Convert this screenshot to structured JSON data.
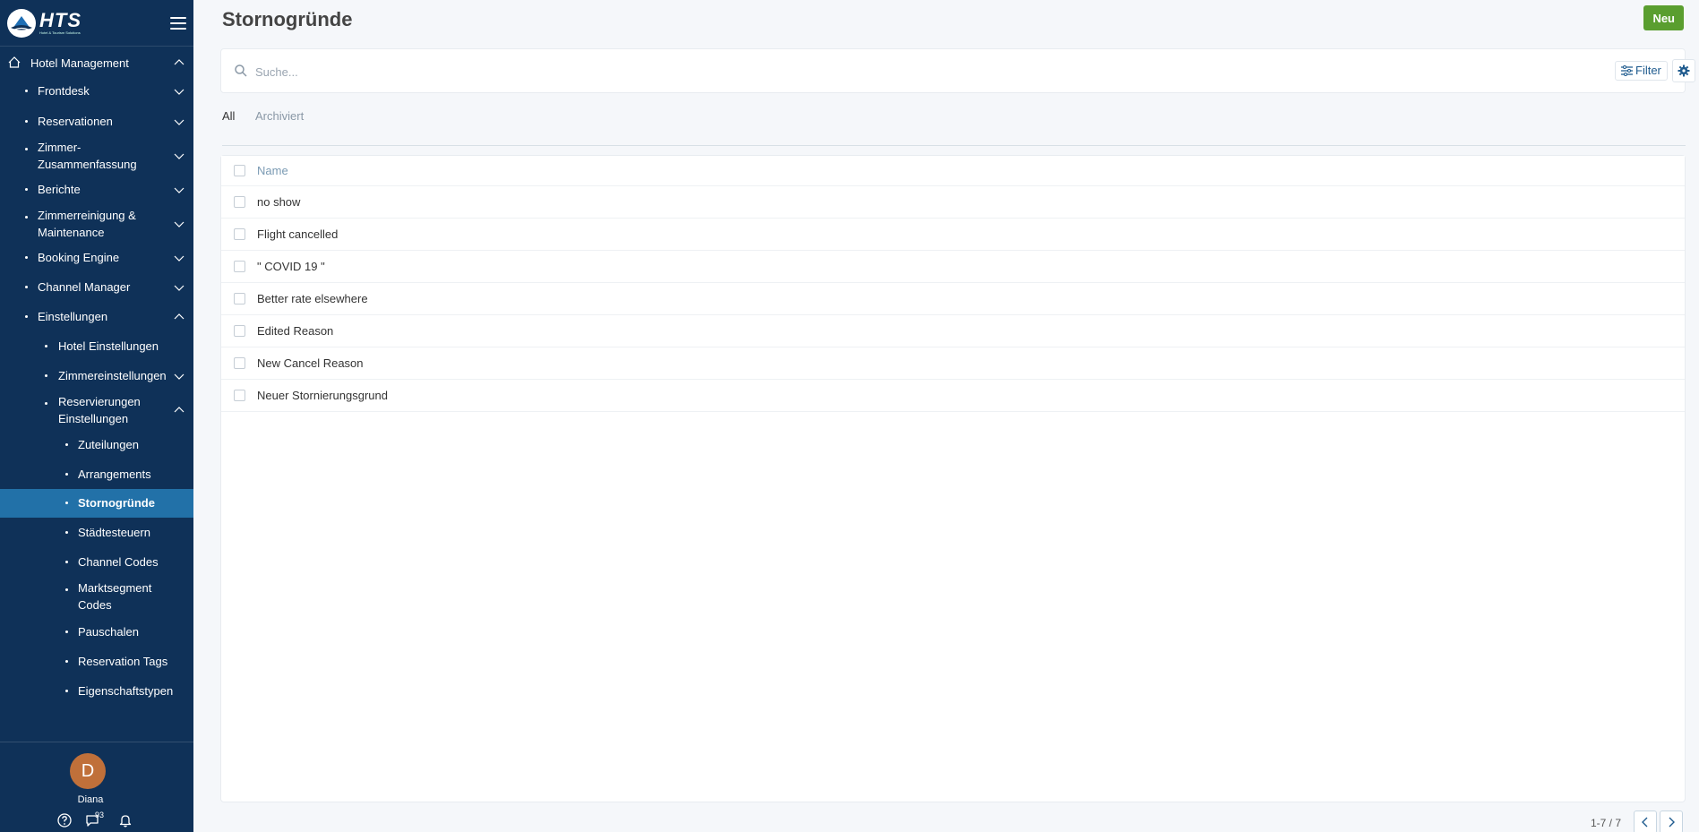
{
  "brand": {
    "name": "HTS",
    "tagline": "Hotel & Tourism Solutions"
  },
  "page": {
    "title": "Stornogründe",
    "new_button": "Neu"
  },
  "search": {
    "placeholder": "Suche...",
    "filter_label": "Filter"
  },
  "tabs": [
    {
      "label": "All",
      "active": true
    },
    {
      "label": "Archiviert",
      "active": false
    }
  ],
  "table": {
    "header": "Name",
    "rows": [
      "no show",
      "Flight cancelled",
      "\" COVID 19 \"",
      "Better rate elsewhere",
      "Edited Reason",
      "New Cancel Reason",
      "Neuer Stornierungsgrund"
    ]
  },
  "pagination": {
    "text": "1-7 / 7"
  },
  "sidebar": {
    "top": {
      "label": "Hotel Management"
    },
    "items": [
      {
        "label": "Frontdesk"
      },
      {
        "label": "Reservationen"
      },
      {
        "label": "Zimmer-\nZusammenfassung"
      },
      {
        "label": "Berichte"
      },
      {
        "label": "Zimmerreinigung &\nMaintenance"
      },
      {
        "label": "Booking Engine"
      },
      {
        "label": "Channel Manager"
      },
      {
        "label": "Einstellungen"
      },
      {
        "label": "Hotel Einstellungen"
      },
      {
        "label": "Zimmereinstellungen"
      },
      {
        "label": "Reservierungen\nEinstellungen"
      },
      {
        "label": "Zuteilungen"
      },
      {
        "label": "Arrangements"
      },
      {
        "label": "Stornogründe"
      },
      {
        "label": "Städtesteuern"
      },
      {
        "label": "Channel Codes"
      },
      {
        "label": "Marktsegment\nCodes"
      },
      {
        "label": "Pauschalen"
      },
      {
        "label": "Reservation Tags"
      },
      {
        "label": "Eigenschaftstypen"
      }
    ],
    "user": {
      "initial": "D",
      "name": "Diana"
    },
    "messages_count": "93"
  },
  "colors": {
    "sidebar_bg": "#0f3158",
    "active_item": "#2271a8",
    "new_button": "#5a9e2f",
    "link_blue": "#1f5b8e"
  }
}
